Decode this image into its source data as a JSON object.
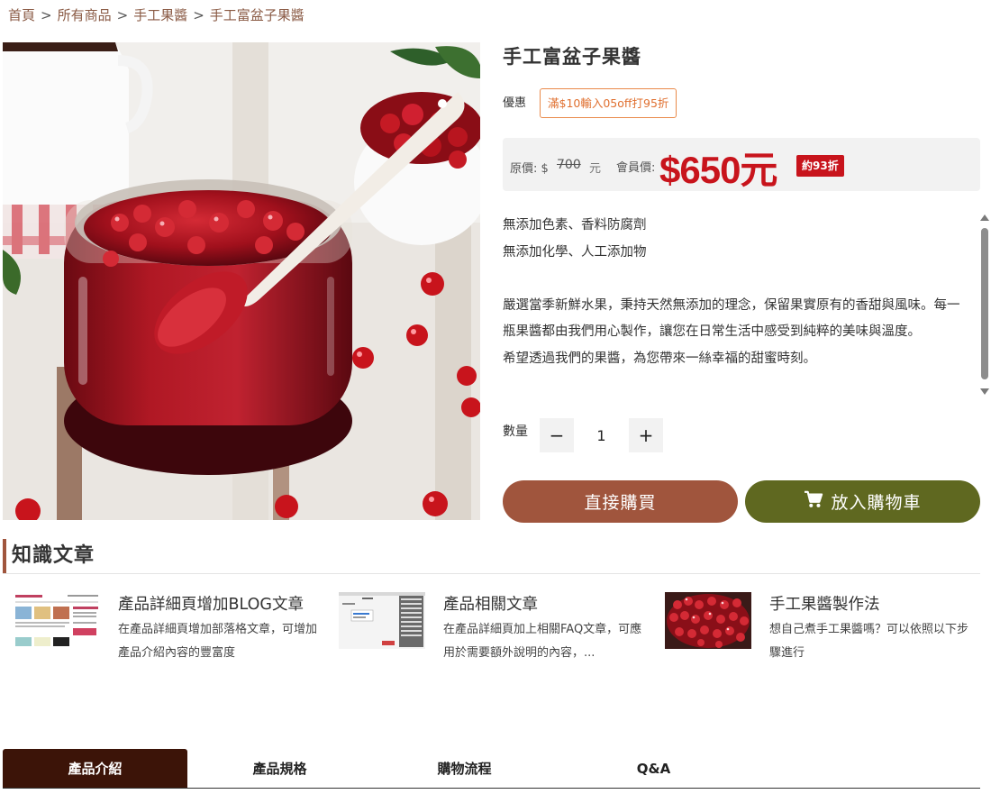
{
  "breadcrumb": [
    "首頁",
    "所有商品",
    "手工果醬",
    "手工富盆子果醬"
  ],
  "product": {
    "title": "手工富盆子果醬",
    "promo_label": "優惠",
    "promo_badge": "滿$10輸入05off打95折",
    "price": {
      "orig_label": "原價: $",
      "orig_value": "700",
      "orig_unit": "元",
      "member_label": "會員價:",
      "member_price": "$650元",
      "discount": "約93折"
    },
    "description": [
      "無添加色素、香料防腐劑",
      "無添加化學、人工添加物",
      "",
      "嚴選當季新鮮水果，秉持天然無添加的理念，保留果實原有的香甜與風味。每一瓶果醬都由我們用心製作，讓您在日常生活中感受到純粹的美味與溫度。",
      "希望透過我們的果醬，為您帶來一絲幸福的甜蜜時刻。"
    ],
    "quantity_label": "數量",
    "quantity_value": "1",
    "qty_minus": "−",
    "qty_plus": "+",
    "buy_now_label": "直接購買",
    "add_to_cart_label": "放入購物車"
  },
  "knowledge": {
    "title": "知識文章",
    "articles": [
      {
        "title": "產品詳細頁增加BLOG文章",
        "excerpt": "在產品詳細頁增加部落格文章，可增加產品介紹內容的豐富度"
      },
      {
        "title": "產品相關文章",
        "excerpt": "在產品詳細頁加上相關FAQ文章，可應用於需要額外說明的內容，..."
      },
      {
        "title": "手工果醬製作法",
        "excerpt": "想自己煮手工果醬嗎？可以依照以下步驟進行"
      }
    ]
  },
  "tabs": [
    "產品介紹",
    "產品規格",
    "購物流程",
    "Q&A"
  ],
  "active_tab": 0,
  "colors": {
    "breadcrumb": "#8a5a44",
    "price_red": "#c8141c",
    "buy_button": "#a0553d",
    "cart_button": "#5f6820",
    "tab_active": "#3c1408",
    "promo_border": "#e98a4a"
  },
  "icons": {
    "cart": "shopping-cart-icon",
    "scroll_up": "triangle-up-icon",
    "scroll_down": "triangle-down-icon"
  }
}
